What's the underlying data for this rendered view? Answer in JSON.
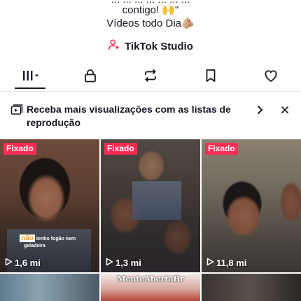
{
  "profile": {
    "bio_line0": "... ... ... ... ... ... ...",
    "bio_line1": "contigo! 🙌\"",
    "bio_line2": "Vídeos todo Dia🫵🏼",
    "studio_label": "TikTok Studio"
  },
  "tabs": [
    {
      "name": "videos-grid",
      "icon": "grid-icon",
      "active": true
    },
    {
      "name": "private",
      "icon": "lock-icon"
    },
    {
      "name": "reposts",
      "icon": "repost-icon"
    },
    {
      "name": "favorites",
      "icon": "bookmark-icon"
    },
    {
      "name": "liked",
      "icon": "heart-icon"
    }
  ],
  "banner": {
    "text": "Receba mais visualizações com as listas de reprodução",
    "icon": "playlist-icon"
  },
  "videos": [
    {
      "pinned_label": "Fixado",
      "views": "1,6 mi",
      "caption_highlight": "não",
      "caption_rest": "tenho fogão nem",
      "caption_line2": "geladeira"
    },
    {
      "pinned_label": "Fixado",
      "views": "1,3 mi"
    },
    {
      "pinned_label": "Fixado",
      "views": "11,8 mi"
    },
    {
      "overlay_text": "MenteAbertaBr"
    }
  ],
  "colors": {
    "accent": "#fe2c55",
    "text": "#161823"
  }
}
